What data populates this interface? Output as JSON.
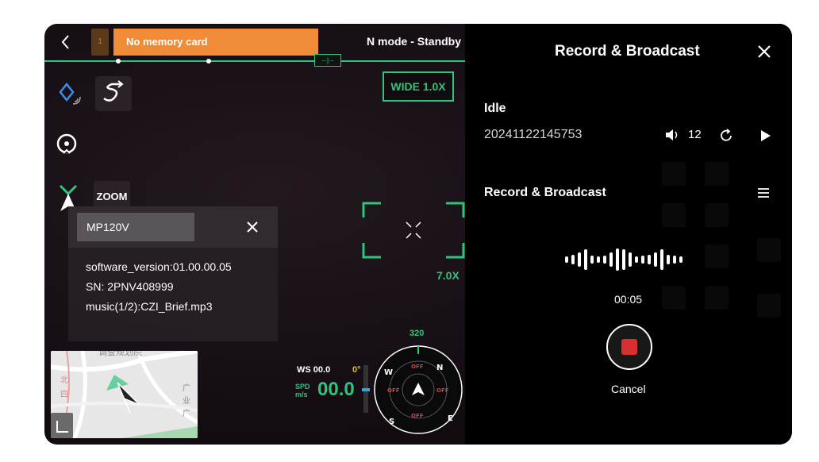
{
  "top_bar": {
    "battery_level": "1",
    "memory_warning": "No memory card",
    "flight_mode": "N mode - Standby"
  },
  "tools": {
    "zoom_label": "ZOOM"
  },
  "info_panel": {
    "model": "MP120V",
    "software_version": "software_version:01.00.00.05",
    "serial": "SN: 2PNV408999",
    "music": "music(1/2):CZI_Brief.mp3"
  },
  "camera": {
    "wide_zoom": "WIDE 1.0X",
    "zoom_factor": "7.0X"
  },
  "telemetry": {
    "wind_speed": "WS 00.0",
    "tilt": "0°",
    "spd_label_1": "SPD",
    "spd_label_2": "m/s",
    "speed": "00.0",
    "heading": "320"
  },
  "compass": {
    "north": "N",
    "west": "W",
    "south": "S",
    "east": "E",
    "off_top": "OFF",
    "off_left": "OFF",
    "off_right": "OFF",
    "off_bottom": "OFF"
  },
  "broadcast": {
    "title": "Record & Broadcast",
    "status": "Idle",
    "recording_name": "20241122145753",
    "volume": "12",
    "section_title": "Record & Broadcast",
    "elapsed": "00:05",
    "cancel_label": "Cancel"
  },
  "colors": {
    "accent_green": "#2fc47a",
    "warning_orange": "#f08c37",
    "record_red": "#d83030"
  }
}
